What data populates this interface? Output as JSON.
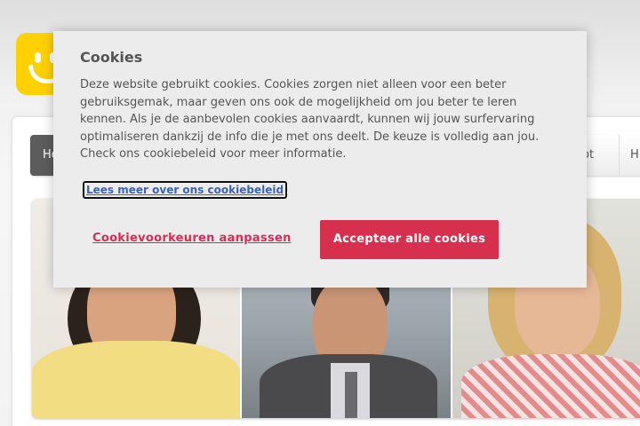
{
  "site": {
    "nav": {
      "home_label": "Ho",
      "hotspot_label": "spot",
      "more_label": "H"
    },
    "brand_color": "#ffd100"
  },
  "cookie_dialog": {
    "title": "Cookies",
    "body": "Deze website gebruikt cookies. Cookies zorgen niet alleen voor een beter gebruiksgemak, maar geven ons ook de mogelijkheid om jou beter te leren kennen. Als je de aanbevolen cookies aanvaardt, kunnen wij jouw surfervaring optimaliseren dankzij de info die je met ons deelt. De keuze is volledig aan jou. Check ons cookiebeleid voor meer informatie.",
    "policy_link": "Lees meer over ons cookiebeleid",
    "preferences_button": "Cookievoorkeuren aanpassen",
    "accept_button": "Accepteer alle cookies",
    "accent_color": "#d7304f",
    "link_color": "#3c63b8"
  }
}
